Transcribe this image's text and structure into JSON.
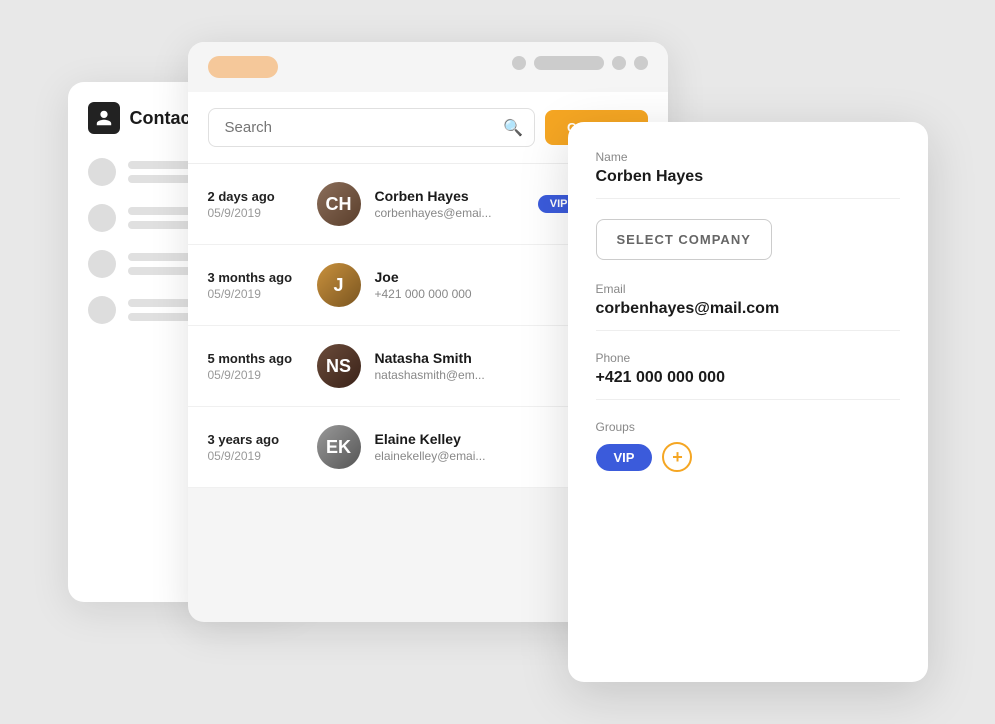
{
  "app": {
    "title": "Contacts"
  },
  "topbar": {
    "pill_color": "#f5c89a",
    "dot_color": "#ccc"
  },
  "search": {
    "placeholder": "Search"
  },
  "create_button": {
    "label": "CREATE"
  },
  "contacts": [
    {
      "time_ago": "2 days ago",
      "date": "05/9/2019",
      "name": "Corben Hayes",
      "sub": "corbenhayes@emai...",
      "avatar_initials": "CH",
      "avatar_class": "avatar-corben"
    },
    {
      "time_ago": "3 months ago",
      "date": "05/9/2019",
      "name": "Joe",
      "sub": "+421 000 000 000",
      "avatar_initials": "J",
      "avatar_class": "avatar-joe"
    },
    {
      "time_ago": "5 months ago",
      "date": "05/9/2019",
      "name": "Natasha Smith",
      "sub": "natashasmith@em...",
      "avatar_initials": "NS",
      "avatar_class": "avatar-natasha"
    },
    {
      "time_ago": "3 years ago",
      "date": "05/9/2019",
      "name": "Elaine Kelley",
      "sub": "elainekelley@emai...",
      "avatar_initials": "EK",
      "avatar_class": "avatar-elaine"
    }
  ],
  "detail": {
    "name_label": "Name",
    "name_value": "Corben Hayes",
    "select_company_label": "SELECT COMPANY",
    "email_label": "Email",
    "email_value": "corbenhayes@mail.com",
    "phone_label": "Phone",
    "phone_value": "+421 000 000 000",
    "groups_label": "Groups",
    "vip_badge": "VIP"
  },
  "sidebar": {
    "title": "Contacts"
  }
}
